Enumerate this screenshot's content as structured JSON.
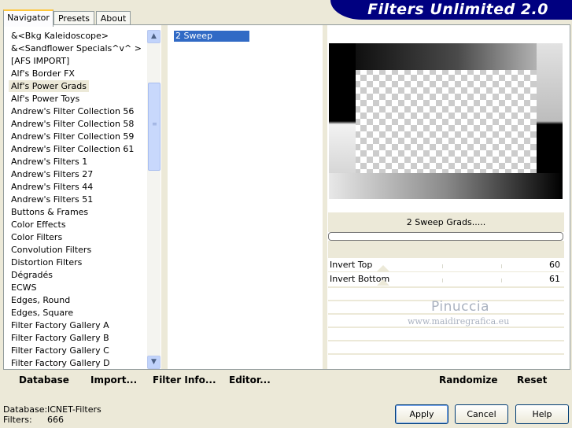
{
  "tabs": [
    "Navigator",
    "Presets",
    "About"
  ],
  "banner": {
    "title": "Filters Unlimited 2.0"
  },
  "categories": [
    "&<Bkg Kaleidoscope>",
    "&<Sandflower Specials^v^ >",
    "[AFS IMPORT]",
    "Alf's Border FX",
    "Alf's Power Grads",
    "Alf's Power Toys",
    "Andrew's Filter Collection 56",
    "Andrew's Filter Collection 58",
    "Andrew's Filter Collection 59",
    "Andrew's Filter Collection 61",
    "Andrew's Filters 1",
    "Andrew's Filters 27",
    "Andrew's Filters 44",
    "Andrew's Filters 51",
    "Buttons & Frames",
    "Color Effects",
    "Color Filters",
    "Convolution Filters",
    "Distortion Filters",
    "Dégradés",
    "ECWS",
    "Edges, Round",
    "Edges, Square",
    "Filter Factory Gallery A",
    "Filter Factory Gallery B",
    "Filter Factory Gallery C",
    "Filter Factory Gallery D"
  ],
  "selected_category": "Alf's Power Grads",
  "filters": [
    "2 Sweep Grads....."
  ],
  "selected_filter_name": "2 Sweep Grads.....",
  "controls": [
    {
      "label": "Invert Top",
      "value": "60"
    },
    {
      "label": "Invert Bottom",
      "value": "61"
    }
  ],
  "watermark": {
    "line1": "Pinuccia",
    "line2": "www.maidiregrafica.eu"
  },
  "left_buttons": {
    "database": "Database",
    "import": "Import...",
    "filter_info": "Filter Info...",
    "editor": "Editor..."
  },
  "right_buttons": {
    "randomize": "Randomize",
    "reset": "Reset"
  },
  "status": {
    "database_label": "Database:",
    "database_value": "ICNET-Filters",
    "filters_label": "Filters:",
    "filters_value": "666"
  },
  "dialog_buttons": {
    "apply": "Apply",
    "cancel": "Cancel",
    "help": "Help"
  },
  "icons": {
    "scroll_up": "chevron-up-icon",
    "scroll_down": "chevron-down-icon"
  }
}
